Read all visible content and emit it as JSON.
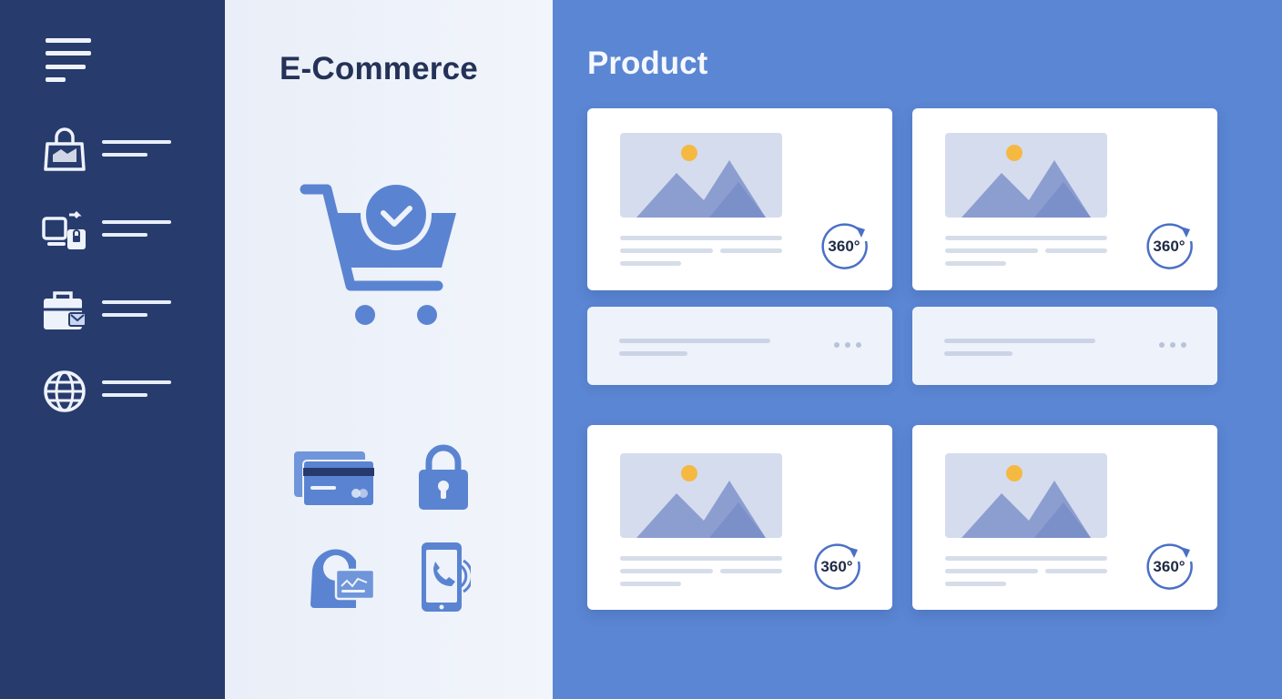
{
  "app": {
    "brand_title": "E-Commerce",
    "section_title": "Product"
  },
  "colors": {
    "sidebar": "#273b6d",
    "accent_blue": "#5b86d3",
    "icon_blue": "#5a84d2",
    "sun": "#f5b942"
  },
  "sidebar": {
    "menu_icon": "hamburger-menu-icon",
    "items": [
      {
        "icon": "shopping-bag-icon"
      },
      {
        "icon": "device-sync-lock-icon"
      },
      {
        "icon": "briefcase-icon"
      },
      {
        "icon": "globe-icon"
      }
    ]
  },
  "features": {
    "cart_icon": "cart-checkmark-icon",
    "payment_icons": [
      "credit-card-icon",
      "padlock-icon",
      "wallet-card-icon",
      "mobile-payment-icon"
    ]
  },
  "products": [
    {
      "badge": "360°"
    },
    {
      "badge": "360°"
    },
    {
      "badge": "360°"
    },
    {
      "badge": "360°"
    }
  ]
}
